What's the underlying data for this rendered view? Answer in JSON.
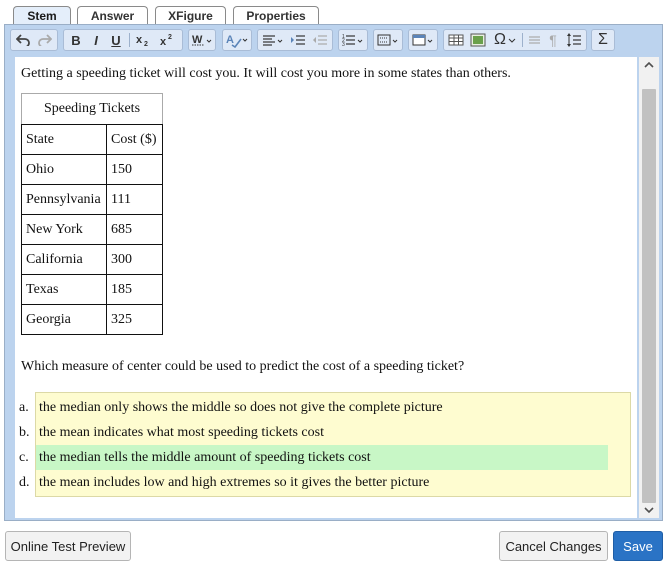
{
  "tabs": [
    {
      "label": "Stem",
      "active": true
    },
    {
      "label": "Answer",
      "active": false
    },
    {
      "label": "XFigure",
      "active": false
    },
    {
      "label": "Properties",
      "active": false
    }
  ],
  "toolbar": {
    "bold": "B",
    "italic": "I",
    "underline": "U",
    "omega": "Ω",
    "sigma": "Σ",
    "icons": [
      "undo-icon",
      "redo-icon",
      "bold-icon",
      "italic-icon",
      "underline-icon",
      "subscript-icon",
      "superscript-icon",
      "text-style-icon",
      "spellcheck-icon",
      "align-icon",
      "indent-icon",
      "outdent-icon",
      "numbered-list-icon",
      "block-format-icon",
      "insert-icon",
      "table-icon",
      "image-icon",
      "special-char-icon",
      "blockquote-icon",
      "paragraph-mark-icon",
      "line-spacing-icon",
      "sigma-icon"
    ]
  },
  "stem": {
    "intro": "Getting a speeding ticket will cost you. It will cost you more in some states than others.",
    "question": "Which measure of center could be used to predict the cost of a speeding ticket?"
  },
  "table": {
    "caption": "Speeding Tickets",
    "headers": [
      "State",
      "Cost ($)"
    ],
    "rows": [
      [
        "Ohio",
        "150"
      ],
      [
        "Pennsylvania",
        "111"
      ],
      [
        "New York",
        "685"
      ],
      [
        "California",
        "300"
      ],
      [
        "Texas",
        "185"
      ],
      [
        "Georgia",
        "325"
      ]
    ]
  },
  "choices": [
    {
      "letter": "a.",
      "text": "the median only shows the middle so does not give the complete picture",
      "correct": false
    },
    {
      "letter": "b.",
      "text": "the mean indicates what most speeding tickets cost",
      "correct": false
    },
    {
      "letter": "c.",
      "text": "the median tells the middle amount of speeding tickets cost",
      "correct": true
    },
    {
      "letter": "d.",
      "text": "the mean includes low and high extremes so it gives the better picture",
      "correct": false
    }
  ],
  "footer": {
    "preview_label": "Online Test Preview",
    "cancel_label": "Cancel Changes",
    "save_label": "Save"
  },
  "colors": {
    "save_button": "#2a73c5",
    "choices_background": "#fefcd0",
    "correct_highlight": "#c8f7c6",
    "editor_border": "#bcd3ee"
  }
}
